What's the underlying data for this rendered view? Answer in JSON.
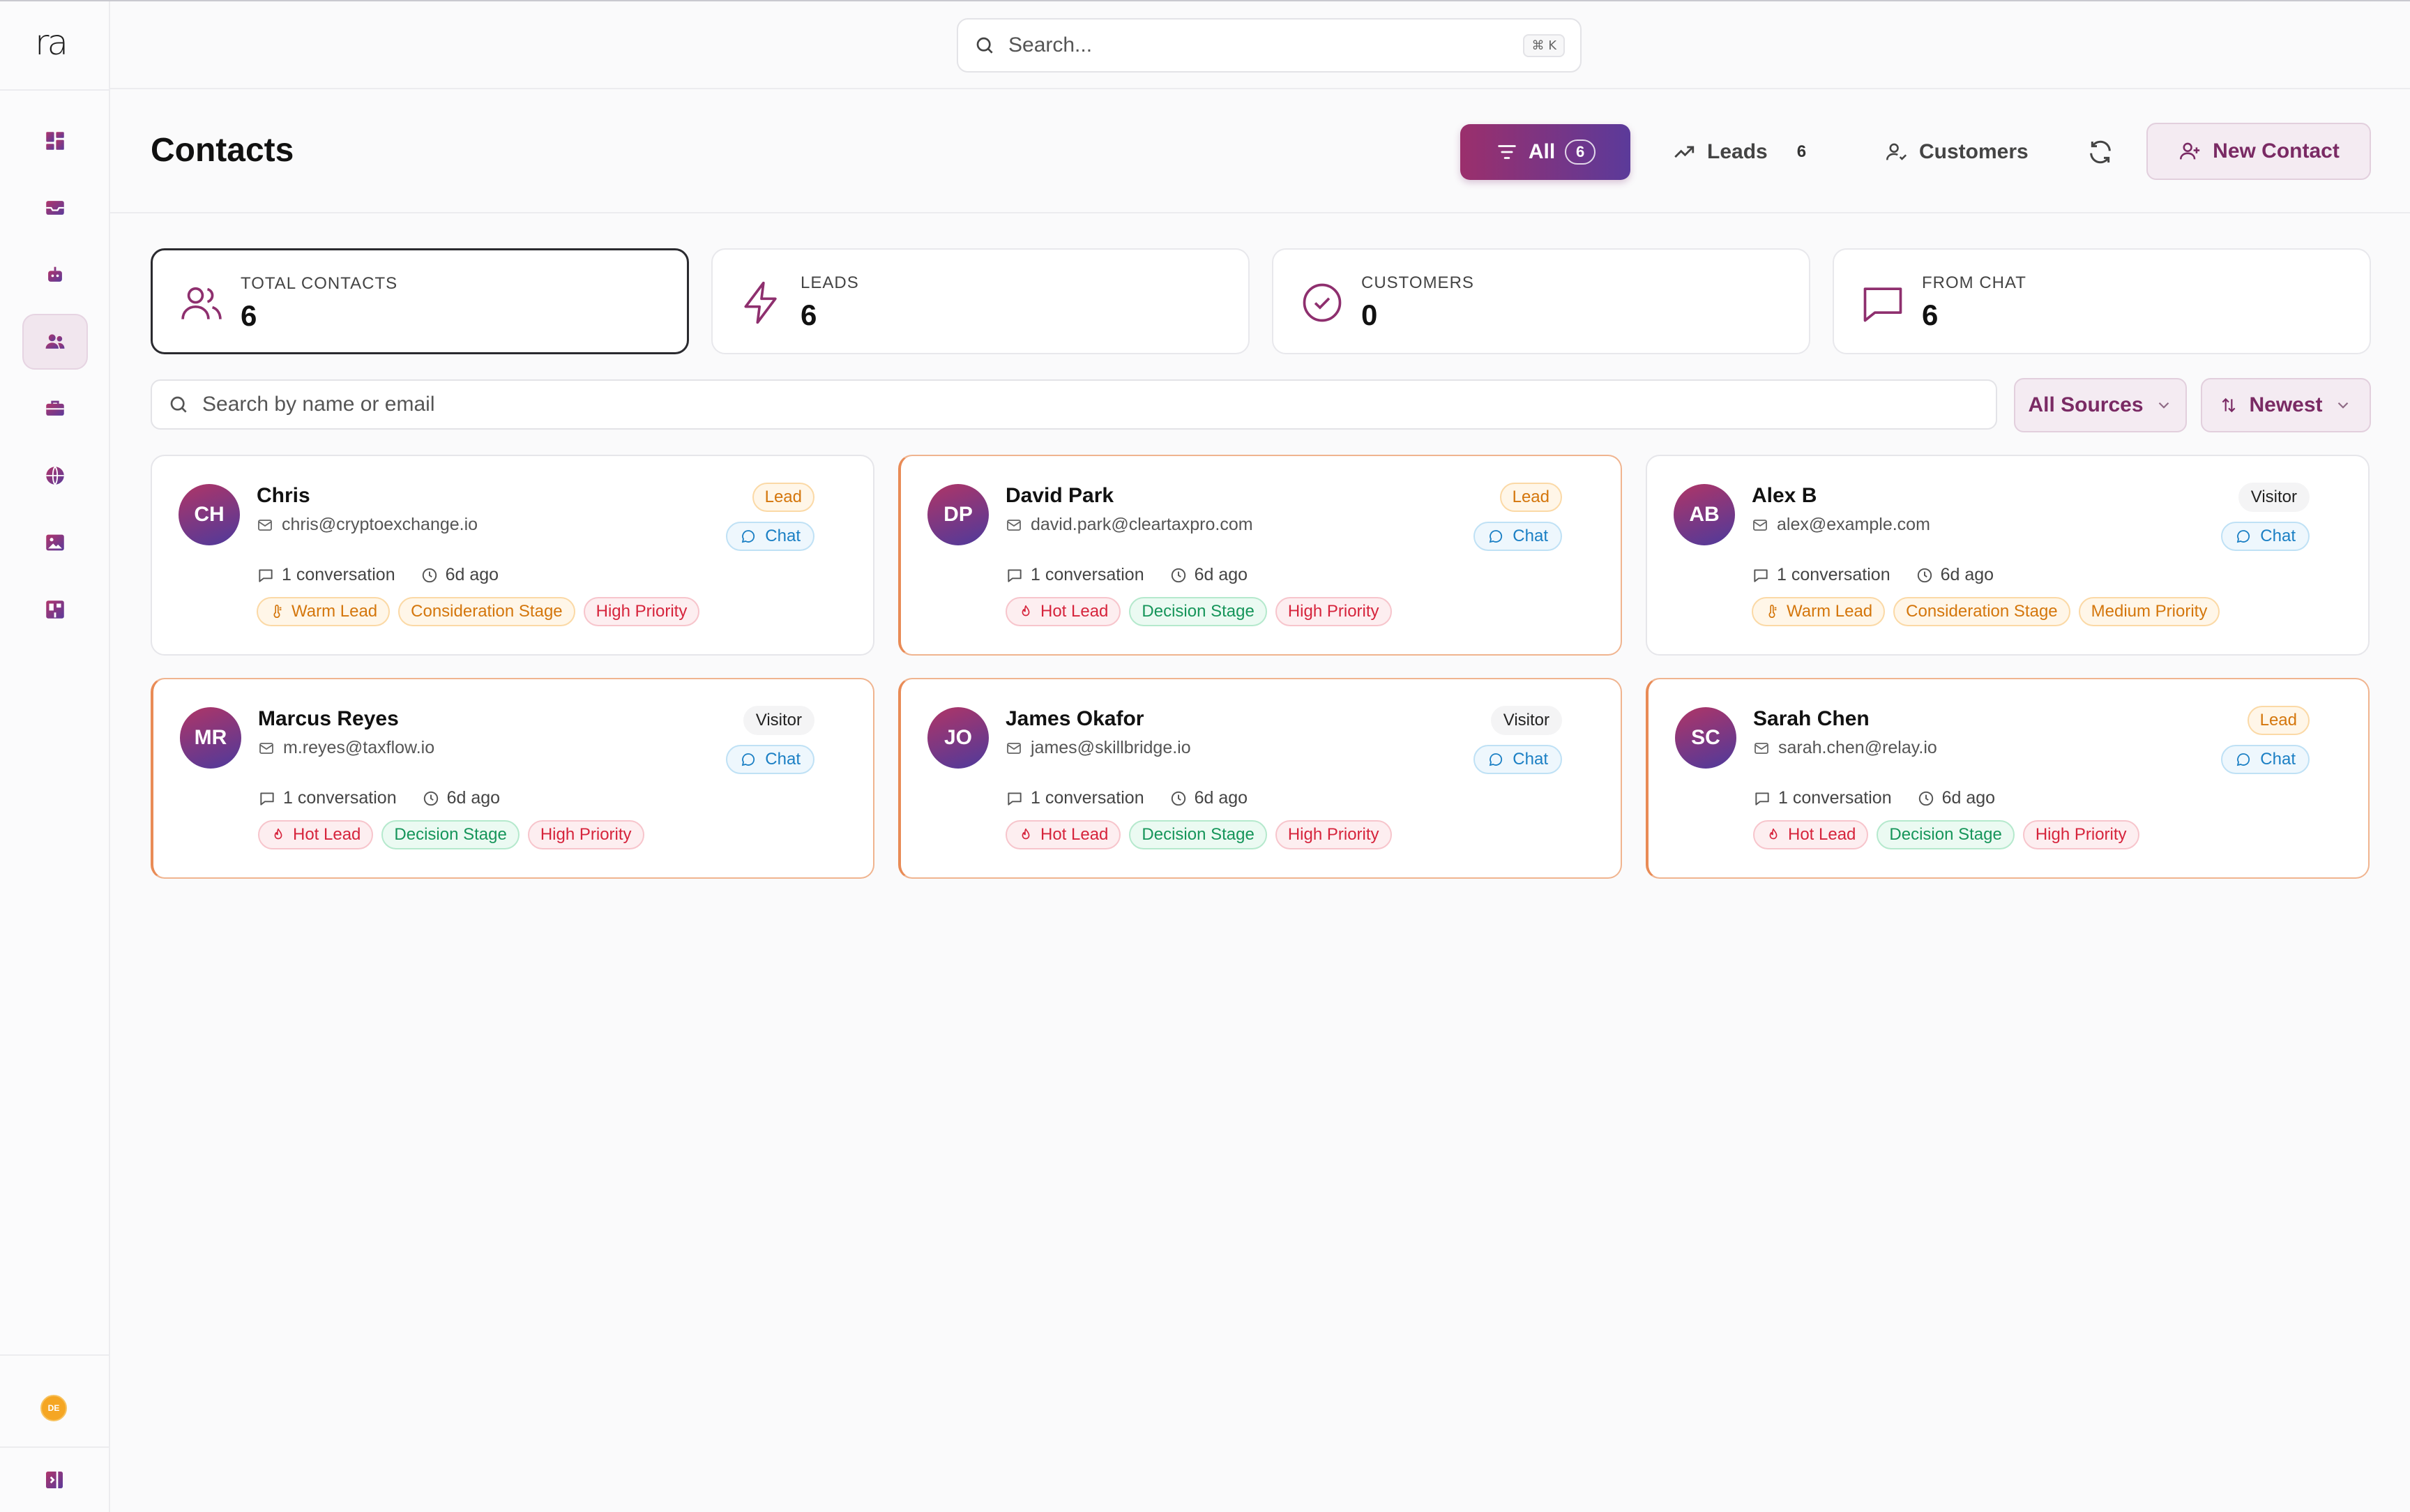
{
  "app": {
    "logo_text": "ra",
    "user_initials": "DE"
  },
  "sidebar": {
    "items": [
      {
        "icon": "dashboard-icon",
        "active": false
      },
      {
        "icon": "inbox-icon",
        "active": false
      },
      {
        "icon": "bot-icon",
        "active": false
      },
      {
        "icon": "contacts-icon",
        "active": true
      },
      {
        "icon": "briefcase-icon",
        "active": false
      },
      {
        "icon": "globe-icon",
        "active": false
      },
      {
        "icon": "image-icon",
        "active": false
      },
      {
        "icon": "widget-icon",
        "active": false
      }
    ]
  },
  "topbar": {
    "search_placeholder": "Search...",
    "shortcut": "⌘ K"
  },
  "header": {
    "title": "Contacts",
    "filters": {
      "all_label": "All",
      "all_count": "6",
      "leads_label": "Leads",
      "leads_count": "6",
      "customers_label": "Customers"
    },
    "new_contact_label": "New Contact"
  },
  "stats": [
    {
      "label": "TOTAL CONTACTS",
      "value": "6",
      "icon": "users-icon"
    },
    {
      "label": "LEADS",
      "value": "6",
      "icon": "lightning-icon"
    },
    {
      "label": "CUSTOMERS",
      "value": "0",
      "icon": "check-circle-icon"
    },
    {
      "label": "FROM CHAT",
      "value": "6",
      "icon": "message-icon"
    }
  ],
  "list_controls": {
    "search_placeholder": "Search by name or email",
    "source_filter": "All Sources",
    "sort": "Newest"
  },
  "contacts": [
    {
      "initials": "CH",
      "name": "Chris",
      "email": "chris@cryptoexchange.io",
      "type": "Lead",
      "channel": "Chat",
      "conversations": "1 conversation",
      "last_seen": "6d ago",
      "tags": [
        "Warm Lead",
        "Consideration Stage",
        "High Priority"
      ]
    },
    {
      "initials": "DP",
      "name": "David Park",
      "email": "david.park@cleartaxpro.com",
      "type": "Lead",
      "channel": "Chat",
      "conversations": "1 conversation",
      "last_seen": "6d ago",
      "tags": [
        "Hot Lead",
        "Decision Stage",
        "High Priority"
      ]
    },
    {
      "initials": "AB",
      "name": "Alex B",
      "email": "alex@example.com",
      "type": "Visitor",
      "channel": "Chat",
      "conversations": "1 conversation",
      "last_seen": "6d ago",
      "tags": [
        "Warm Lead",
        "Consideration Stage",
        "Medium Priority"
      ]
    },
    {
      "initials": "MR",
      "name": "Marcus Reyes",
      "email": "m.reyes@taxflow.io",
      "type": "Visitor",
      "channel": "Chat",
      "conversations": "1 conversation",
      "last_seen": "6d ago",
      "tags": [
        "Hot Lead",
        "Decision Stage",
        "High Priority"
      ]
    },
    {
      "initials": "JO",
      "name": "James Okafor",
      "email": "james@skillbridge.io",
      "type": "Visitor",
      "channel": "Chat",
      "conversations": "1 conversation",
      "last_seen": "6d ago",
      "tags": [
        "Hot Lead",
        "Decision Stage",
        "High Priority"
      ]
    },
    {
      "initials": "SC",
      "name": "Sarah Chen",
      "email": "sarah.chen@relay.io",
      "type": "Lead",
      "channel": "Chat",
      "conversations": "1 conversation",
      "last_seen": "6d ago",
      "tags": [
        "Hot Lead",
        "Decision Stage",
        "High Priority"
      ]
    }
  ],
  "colors": {
    "accent": "#8e2f6e",
    "accent_secondary": "#5b3a9a",
    "hot_border": "#e98b56"
  }
}
